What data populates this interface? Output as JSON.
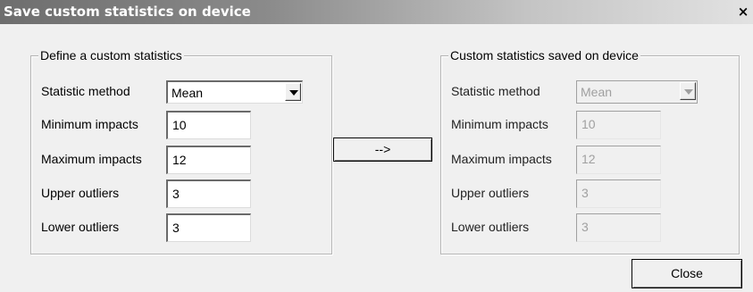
{
  "window": {
    "title": "Save custom statistics on device",
    "close_glyph": "×"
  },
  "define_group": {
    "legend": "Define a custom statistics",
    "statistic_method_label": "Statistic method",
    "statistic_method_value": "Mean",
    "minimum_impacts_label": "Minimum impacts",
    "minimum_impacts_value": "10",
    "maximum_impacts_label": "Maximum impacts",
    "maximum_impacts_value": "12",
    "upper_outliers_label": "Upper outliers",
    "upper_outliers_value": "3",
    "lower_outliers_label": "Lower outliers",
    "lower_outliers_value": "3"
  },
  "transfer_button_label": "-->",
  "saved_group": {
    "legend": "Custom statistics saved on device",
    "statistic_method_label": "Statistic method",
    "statistic_method_value": "Mean",
    "minimum_impacts_label": "Minimum impacts",
    "minimum_impacts_value": "10",
    "maximum_impacts_label": "Maximum impacts",
    "maximum_impacts_value": "12",
    "upper_outliers_label": "Upper outliers",
    "upper_outliers_value": "3",
    "lower_outliers_label": "Lower outliers",
    "lower_outliers_value": "3"
  },
  "close_button_label": "Close"
}
